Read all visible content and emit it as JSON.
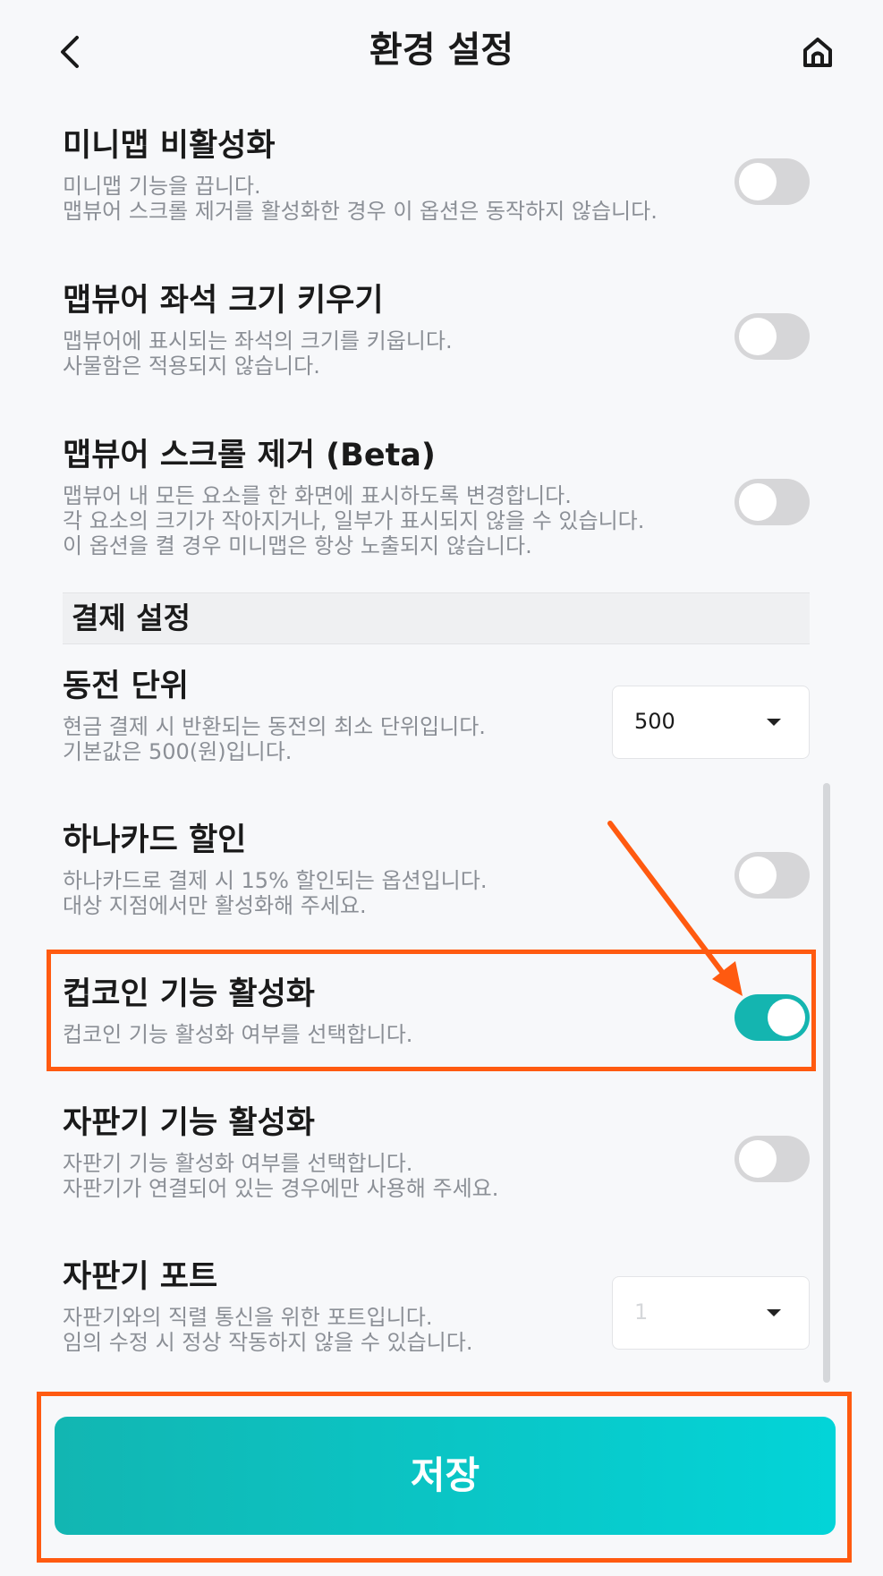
{
  "header": {
    "title": "환경 설정",
    "back_icon": "chevron-left-icon",
    "home_icon": "home-icon"
  },
  "settings": [
    {
      "title": "미니맵 비활성화",
      "desc": [
        "미니맵 기능을 끕니다.",
        "맵뷰어 스크롤 제거를 활성화한 경우 이 옵션은 동작하지 않습니다."
      ],
      "enabled": false
    },
    {
      "title": "맵뷰어 좌석 크기 키우기",
      "desc": [
        "맵뷰어에 표시되는 좌석의 크기를 키웁니다.",
        "사물함은 적용되지 않습니다."
      ],
      "enabled": false
    },
    {
      "title": "맵뷰어 스크롤 제거 (Beta)",
      "desc": [
        "맵뷰어 내 모든 요소를 한 화면에 표시하도록 변경합니다.",
        "각 요소의 크기가 작아지거나, 일부가 표시되지 않을 수 있습니다.",
        "이 옵션을 켤 경우 미니맵은 항상 노출되지 않습니다."
      ],
      "enabled": false
    }
  ],
  "payment_section": {
    "label": "결제 설정"
  },
  "payment": [
    {
      "title": "동전 단위",
      "desc": [
        "현금 결제 시 반환되는 동전의 최소 단위입니다.",
        "기본값은 500(원)입니다."
      ],
      "value": "500"
    },
    {
      "title": "하나카드 할인",
      "desc": [
        "하나카드로 결제 시 15% 할인되는 옵션입니다.",
        "대상 지점에서만 활성화해 주세요."
      ],
      "enabled": false
    },
    {
      "title": "컵코인 기능 활성화",
      "desc": [
        "컵코인 기능 활성화 여부를 선택합니다."
      ],
      "enabled": true
    },
    {
      "title": "자판기 기능 활성화",
      "desc": [
        "자판기 기능 활성화 여부를 선택합니다.",
        "자판기가 연결되어 있는 경우에만 사용해 주세요."
      ],
      "enabled": false
    },
    {
      "title": "자판기 포트",
      "desc": [
        "자판기와의 직렬 통신을 위한 포트입니다.",
        "임의 수정 시 정상 작동하지 않을 수 있습니다."
      ],
      "value": "1",
      "disabled": true
    }
  ],
  "save_label": "저장",
  "colors": {
    "accent": "#14b5b0",
    "highlight": "#ff5a10",
    "toggle_off": "#d6d6d8"
  }
}
